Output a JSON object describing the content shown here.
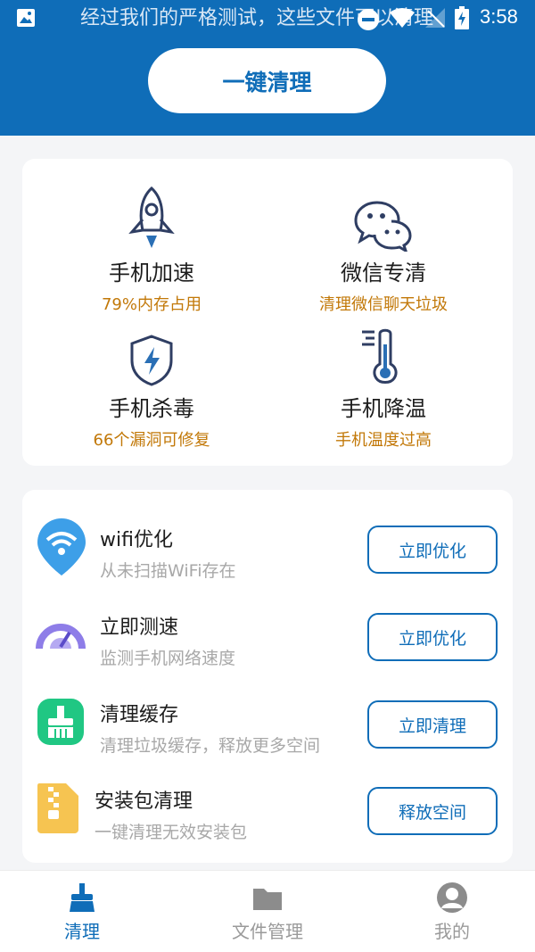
{
  "status_bar": {
    "notification_text": "经过我们的严格测试，这些文件可以清理",
    "time": "3:58",
    "icons": [
      "image-icon",
      "dnd-icon",
      "wifi-icon",
      "signal-icon",
      "battery-icon"
    ]
  },
  "header": {
    "one_click_clean": "一键清理",
    "bg_color": "#0f6db8"
  },
  "features": [
    {
      "title": "手机加速",
      "subtitle": "79%内存占用",
      "icon": "rocket-icon"
    },
    {
      "title": "微信专清",
      "subtitle": "清理微信聊天垃圾",
      "icon": "wechat-icon"
    },
    {
      "title": "手机杀毒",
      "subtitle": "66个漏洞可修复",
      "icon": "shield-icon"
    },
    {
      "title": "手机降温",
      "subtitle": "手机温度过高",
      "icon": "thermometer-icon"
    }
  ],
  "tools": [
    {
      "title": "wifi优化",
      "subtitle": "从未扫描WiFi存在",
      "button": "立即优化",
      "icon": "wifi-pin-icon"
    },
    {
      "title": "立即测速",
      "subtitle": "监测手机网络速度",
      "button": "立即优化",
      "icon": "speedometer-icon"
    },
    {
      "title": "清理缓存",
      "subtitle": "清理垃圾缓存，释放更多空间",
      "button": "立即清理",
      "icon": "broom-icon"
    },
    {
      "title": "安装包清理",
      "subtitle": "一键清理无效安装包",
      "button": "释放空间",
      "icon": "zip-file-icon"
    }
  ],
  "bottom_nav": [
    {
      "label": "清理",
      "active": true,
      "icon": "broom-tab-icon"
    },
    {
      "label": "文件管理",
      "active": false,
      "icon": "folder-icon"
    },
    {
      "label": "我的",
      "active": false,
      "icon": "user-icon"
    }
  ],
  "colors": {
    "accent": "#0f6db8",
    "subtitle_orange": "#c27808",
    "inactive_gray": "#9a9a9a"
  }
}
